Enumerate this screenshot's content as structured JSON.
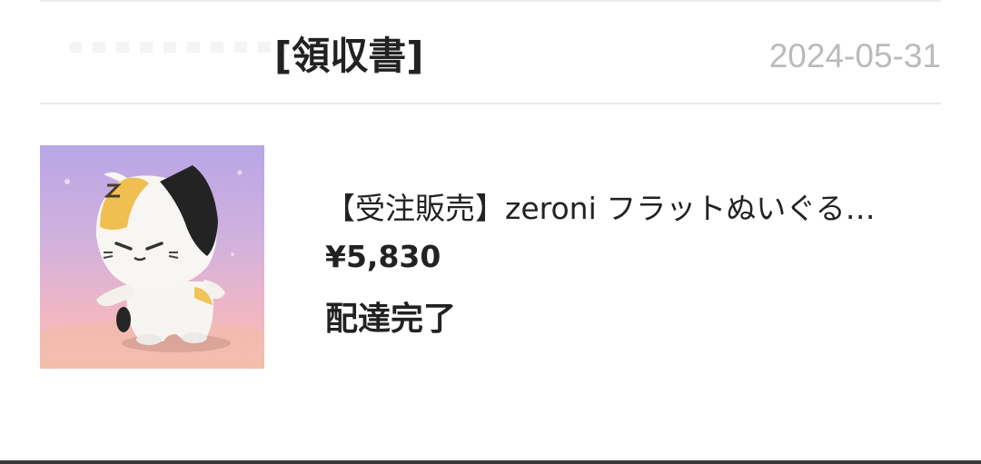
{
  "receipt": {
    "label": "[領収書]",
    "date": "2024-05-31"
  },
  "product": {
    "title": "【受注販売】zeroni フラットぬいぐる…",
    "price": "¥5,830",
    "status": "配達完了",
    "image_icon": "plush-cat-image"
  },
  "colors": {
    "text": "#222222",
    "date": "#bbbbbb",
    "divider": "#e9e9e9",
    "thumb_top": "#b7a6e6",
    "thumb_bottom": "#f6c4b4"
  }
}
